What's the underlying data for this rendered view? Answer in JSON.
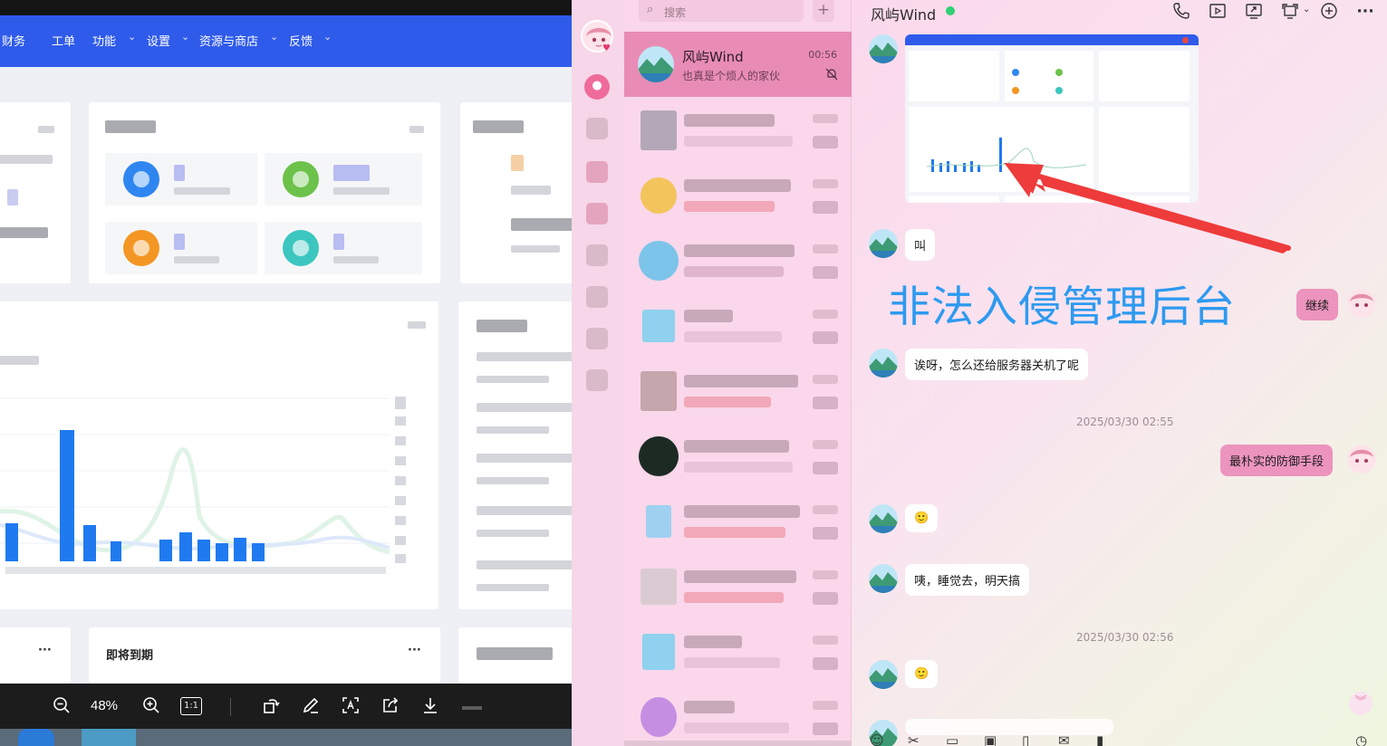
{
  "viewer": {
    "navbar": {
      "items": [
        "财务",
        "工单",
        "功能",
        "设置",
        "资源与商店",
        "反馈"
      ],
      "chevron": "chevron-down-icon"
    },
    "cards": {
      "expiring_title": "即将到期",
      "more_label": "···"
    },
    "toolbar": {
      "zoom_out_icon": "zoom-out-icon",
      "zoom_label": "48%",
      "zoom_in_icon": "zoom-in-icon",
      "actual_size_label": "1:1",
      "rotate_icon": "rotate-icon",
      "edit_icon": "edit-icon",
      "ocr_icon": "ocr-icon",
      "share_icon": "share-icon",
      "download_icon": "download-icon"
    }
  },
  "rail": {
    "chat_icon": "chat-bubble-icon"
  },
  "conversations": {
    "search_placeholder": "搜索",
    "add_label": "+",
    "active": {
      "name": "风屿Wind",
      "preview": "也真是个烦人的家伙",
      "time": "00:56",
      "muted_icon": "bell-off-icon"
    }
  },
  "chat": {
    "title": "风屿Wind",
    "online": true,
    "header_icons": [
      "phone-icon",
      "video-icon",
      "screen-share-icon",
      "remote-desktop-icon",
      "add-circle-icon",
      "more-icon"
    ],
    "annotation": "非法入侵管理后台",
    "messages": [
      {
        "side": "left",
        "type": "image"
      },
      {
        "side": "left",
        "text": "叫"
      },
      {
        "side": "right",
        "text": "继续"
      },
      {
        "side": "left",
        "text": "诶呀，怎么还给服务器关机了呢"
      },
      {
        "side": "center",
        "text": "2025/03/30 02:55"
      },
      {
        "side": "right",
        "text": "最朴实的防御手段"
      },
      {
        "side": "left",
        "text": "🙂"
      },
      {
        "side": "left",
        "text": "咦，睡觉去，明天搞"
      },
      {
        "side": "center",
        "text": "2025/03/30 02:56"
      },
      {
        "side": "left",
        "text": "🙂"
      }
    ],
    "scroll_down_icon": "double-chevron-down-icon",
    "input_icons": [
      "emoji-icon",
      "scissors-icon",
      "folder-icon",
      "image-icon",
      "shake-icon",
      "mail-icon",
      "mic-icon",
      "history-icon"
    ]
  },
  "colors": {
    "viewer_nav": "#2f5bea",
    "chat_accent": "#ec94be",
    "online": "#2fcf73",
    "annotation": "#2d9af0",
    "arrow": "#ee3b3b"
  }
}
